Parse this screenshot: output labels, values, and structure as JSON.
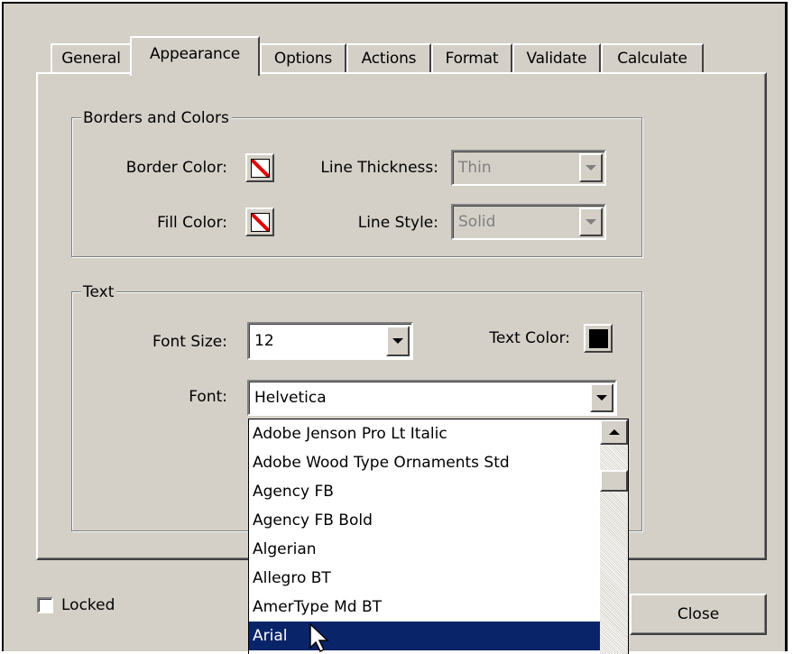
{
  "tabs": [
    {
      "label": "General"
    },
    {
      "label": "Appearance",
      "active": true
    },
    {
      "label": "Options"
    },
    {
      "label": "Actions"
    },
    {
      "label": "Format"
    },
    {
      "label": "Validate"
    },
    {
      "label": "Calculate"
    }
  ],
  "borders_group": {
    "title": "Borders and Colors",
    "border_color_label": "Border Color:",
    "fill_color_label": "Fill Color:",
    "line_thickness_label": "Line Thickness:",
    "line_thickness_value": "Thin",
    "line_style_label": "Line Style:",
    "line_style_value": "Solid",
    "border_color": "transparent",
    "fill_color": "transparent"
  },
  "text_group": {
    "title": "Text",
    "font_size_label": "Font Size:",
    "font_size_value": "12",
    "text_color_label": "Text Color:",
    "text_color": "#000000",
    "font_label": "Font:",
    "font_value": "Helvetica"
  },
  "font_list": {
    "items": [
      "Adobe Jenson Pro Lt Italic",
      "Adobe Wood Type Ornaments Std",
      "Agency FB",
      "Agency FB Bold",
      "Algerian",
      "Allegro BT",
      "AmerType Md BT",
      "Arial"
    ],
    "selected": "Arial"
  },
  "footer": {
    "locked_label": "Locked",
    "locked_checked": false,
    "close_label": "Close"
  },
  "colors": {
    "dialog_bg": "#d4d0c8",
    "selection": "#0a246a",
    "no_color_slash": "#e00000"
  },
  "icons": [
    "no-color-swatch-icon",
    "dropdown-arrow-icon",
    "scroll-up-arrow-icon",
    "mouse-pointer-icon"
  ]
}
